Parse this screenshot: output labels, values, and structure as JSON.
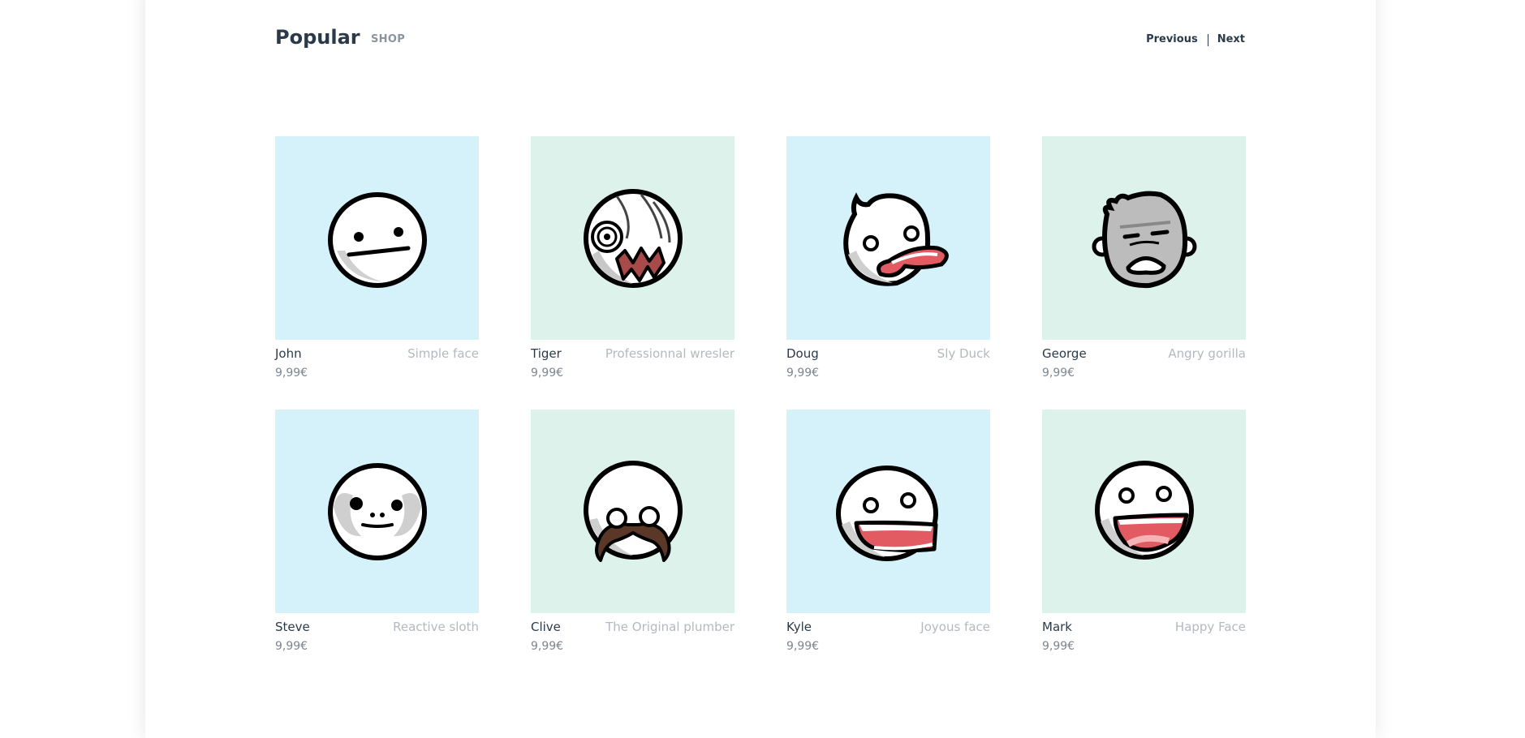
{
  "header": {
    "title": "Popular",
    "subtitle": "SHOP",
    "prev_label": "Previous",
    "next_label": "Next"
  },
  "products": [
    {
      "name": "John",
      "description": "Simple face",
      "price": "9,99€",
      "bg": "#d5f1f9",
      "icon": "simple-face-icon"
    },
    {
      "name": "Tiger",
      "description": "Professionnal wresler",
      "price": "9,99€",
      "bg": "#dcf2ea",
      "icon": "wrestler-mask-icon"
    },
    {
      "name": "Doug",
      "description": "Sly Duck",
      "price": "9,99€",
      "bg": "#d5f1f9",
      "icon": "duck-face-icon"
    },
    {
      "name": "George",
      "description": "Angry gorilla",
      "price": "9,99€",
      "bg": "#dcf2ea",
      "icon": "gorilla-face-icon"
    },
    {
      "name": "Steve",
      "description": "Reactive sloth",
      "price": "9,99€",
      "bg": "#d5f1f9",
      "icon": "sloth-face-icon"
    },
    {
      "name": "Clive",
      "description": "The Original plumber",
      "price": "9,99€",
      "bg": "#dcf2ea",
      "icon": "mustache-face-icon"
    },
    {
      "name": "Kyle",
      "description": "Joyous face",
      "price": "9,99€",
      "bg": "#d5f1f9",
      "icon": "joyous-face-icon"
    },
    {
      "name": "Mark",
      "description": "Happy Face",
      "price": "9,99€",
      "bg": "#dcf2ea",
      "icon": "happy-face-icon"
    }
  ]
}
